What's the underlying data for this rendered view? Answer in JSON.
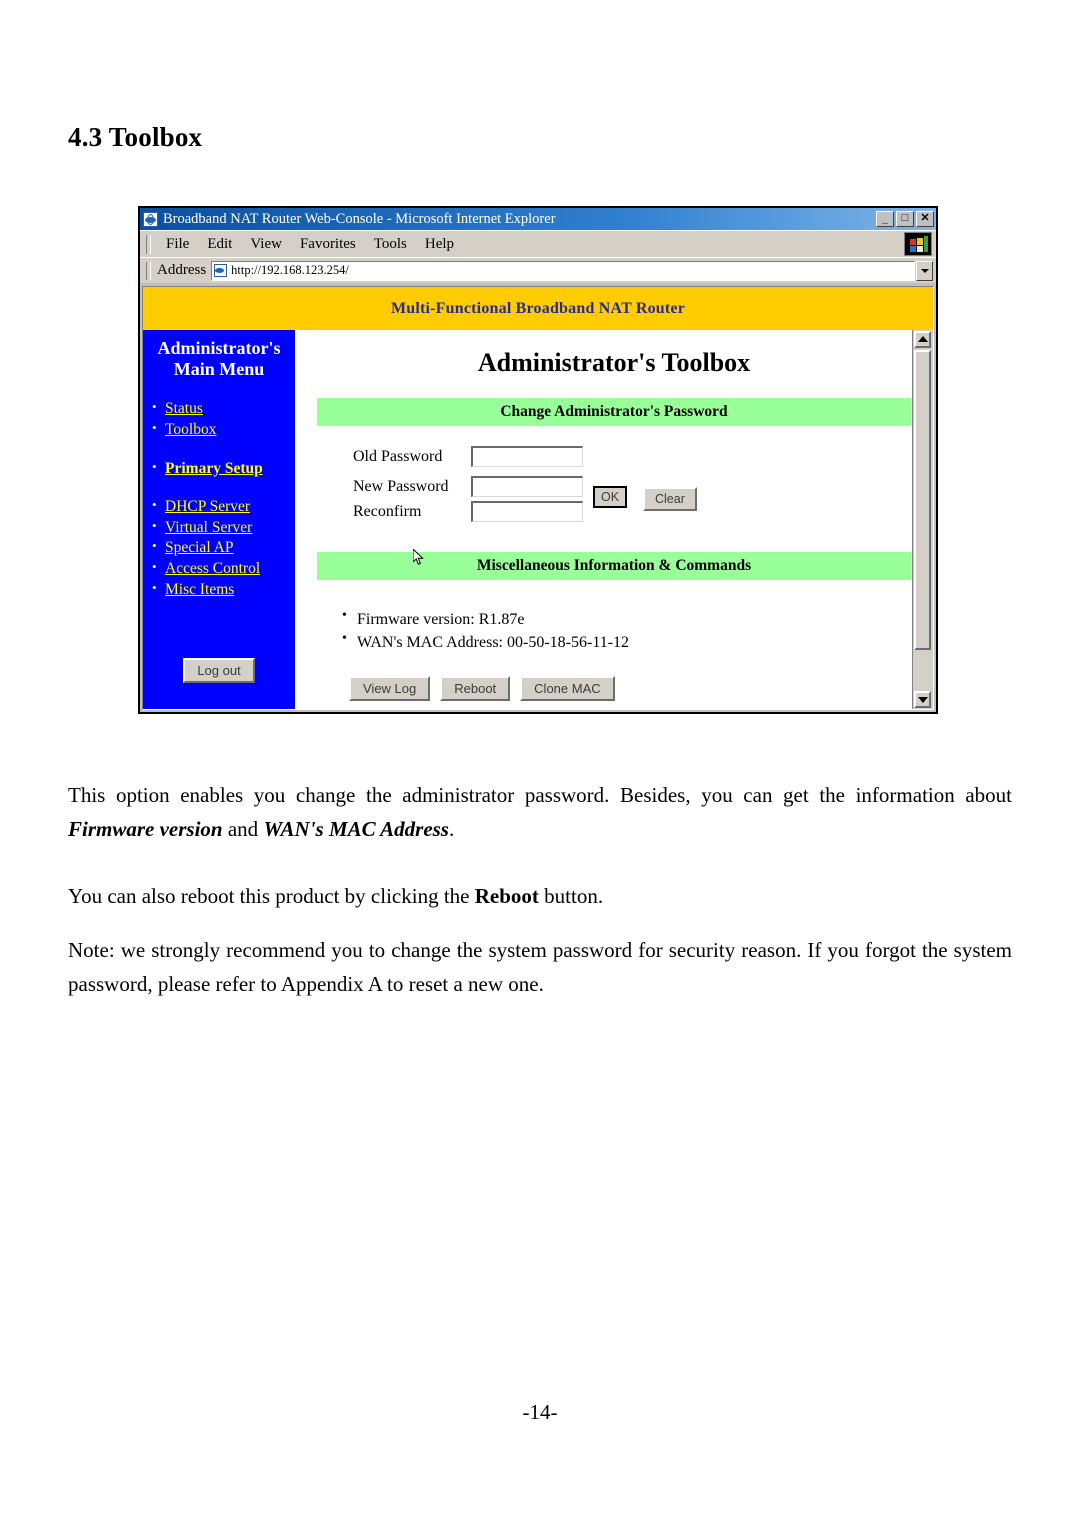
{
  "document": {
    "section_heading": "4.3 Toolbox",
    "page_number": "-14-",
    "paragraphs": {
      "p1_a": "This option enables you change the administrator password. Besides, you can get the information about ",
      "p1_b": "Firmware version",
      "p1_c": " and ",
      "p1_d": "WAN's MAC Address",
      "p1_e": ".",
      "p2_a": "You can also reboot this product by clicking the ",
      "p2_b": "Reboot",
      "p2_c": " button.",
      "p3": "Note: we strongly recommend you to change the system password for security reason. If you forgot the system password, please refer to Appendix A to reset a new one."
    }
  },
  "browser": {
    "title": "Broadband NAT Router Web-Console - Microsoft Internet Explorer",
    "window_buttons": {
      "minimize": "_",
      "maximize": "□",
      "close": "✕"
    },
    "menu": [
      {
        "label": "File",
        "mnemonic": "F"
      },
      {
        "label": "Edit",
        "mnemonic": "E"
      },
      {
        "label": "View",
        "mnemonic": "V"
      },
      {
        "label": "Favorites",
        "mnemonic": "a"
      },
      {
        "label": "Tools",
        "mnemonic": "T"
      },
      {
        "label": "Help",
        "mnemonic": "H"
      }
    ],
    "address": {
      "label": "Address",
      "url": "http://192.168.123.254/"
    }
  },
  "router_page": {
    "banner": "Multi-Functional Broadband NAT Router",
    "sidebar": {
      "title_line1": "Administrator's",
      "title_line2": "Main Menu",
      "items": [
        {
          "label": "Status",
          "bold": false,
          "gap": false
        },
        {
          "label": "Toolbox",
          "bold": false,
          "gap": false
        },
        {
          "label": "Primary Setup",
          "bold": true,
          "gap": true
        },
        {
          "label": "DHCP Server",
          "bold": false,
          "gap": true
        },
        {
          "label": "Virtual Server",
          "bold": false,
          "gap": false
        },
        {
          "label": "Special AP",
          "bold": false,
          "gap": false
        },
        {
          "label": "Access Control",
          "bold": false,
          "gap": false
        },
        {
          "label": "Misc Items",
          "bold": false,
          "gap": false
        }
      ],
      "logout_label": "Log out"
    },
    "content": {
      "title": "Administrator's Toolbox",
      "password_section": {
        "heading": "Change Administrator's Password",
        "fields": [
          {
            "label": "Old Password",
            "value": "",
            "placeholder": ""
          },
          {
            "label": "New Password",
            "value": "",
            "placeholder": ""
          },
          {
            "label": "Reconfirm",
            "value": "",
            "placeholder": ""
          }
        ],
        "ok_label": "OK",
        "clear_label": "Clear"
      },
      "misc_section": {
        "heading": "Miscellaneous Information & Commands",
        "info": [
          "Firmware version: R1.87e",
          "WAN's MAC Address: 00-50-18-56-11-12"
        ],
        "buttons": [
          "View Log",
          "Reboot",
          "Clone MAC"
        ]
      }
    }
  },
  "colors": {
    "banner_bg": "#FFCC00",
    "banner_text": "#2B2B8F",
    "sidebar_bg": "#0000FF",
    "sidebar_link": "#FFFF00",
    "section_bar_bg": "#99FF99",
    "titlebar_bg": "#0B4FA0"
  }
}
